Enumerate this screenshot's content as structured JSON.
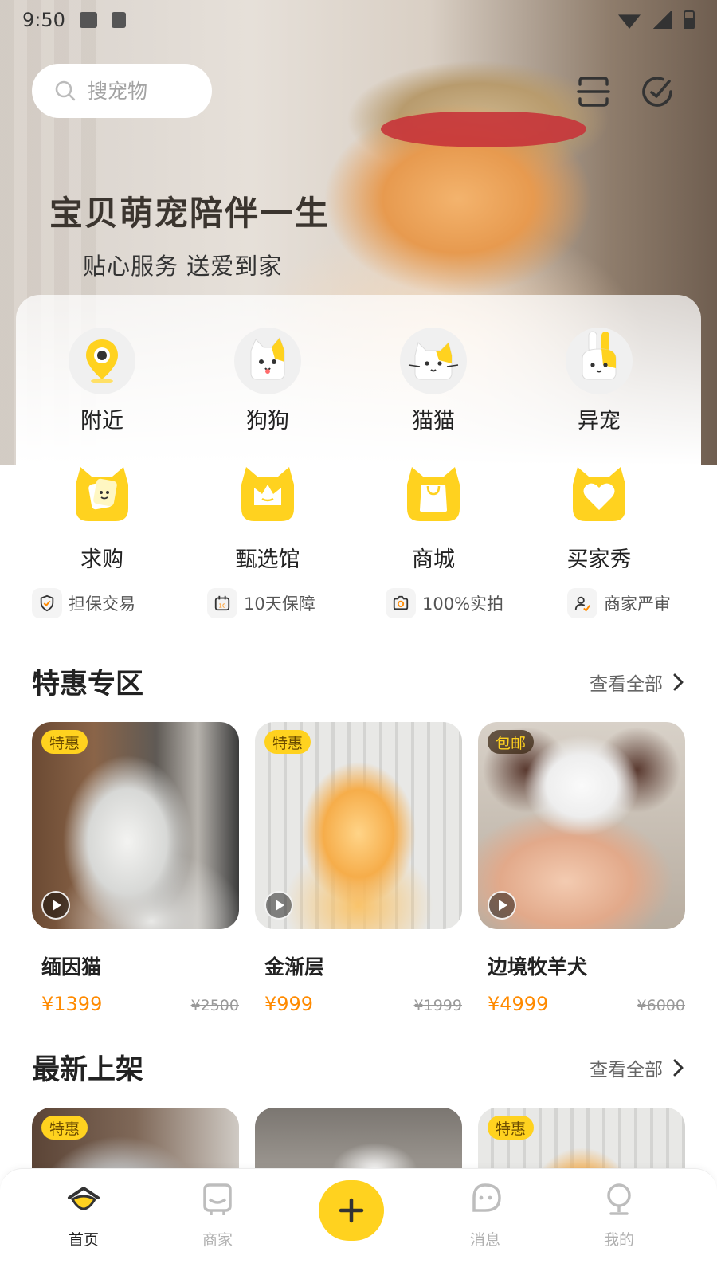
{
  "status_bar": {
    "time": "9:50"
  },
  "search": {
    "placeholder": "搜宠物"
  },
  "hero": {
    "slogan_main": "宝贝萌宠陪伴一生",
    "slogan_sub": "贴心服务 送爱到家"
  },
  "categories_row1": [
    {
      "label": "附近",
      "icon": "location-pin-icon"
    },
    {
      "label": "狗狗",
      "icon": "dog-icon"
    },
    {
      "label": "猫猫",
      "icon": "cat-icon"
    },
    {
      "label": "异宠",
      "icon": "rabbit-icon"
    }
  ],
  "categories_row2": [
    {
      "label": "求购",
      "icon": "wanted-icon"
    },
    {
      "label": "甄选馆",
      "icon": "crown-icon"
    },
    {
      "label": "商城",
      "icon": "shopping-bag-icon"
    },
    {
      "label": "买家秀",
      "icon": "heart-icon"
    }
  ],
  "guarantees": [
    {
      "label": "担保交易",
      "icon": "shield-check-icon"
    },
    {
      "label": "10天保障",
      "icon": "calendar-icon"
    },
    {
      "label": "100%实拍",
      "icon": "camera-icon"
    },
    {
      "label": "商家严审",
      "icon": "user-check-icon"
    }
  ],
  "section_deals": {
    "title": "特惠专区",
    "more": "查看全部",
    "items": [
      {
        "tag": "特惠",
        "name": "缅因猫",
        "price": "¥1399",
        "old_price": "¥2500"
      },
      {
        "tag": "特惠",
        "name": "金渐层",
        "price": "¥999",
        "old_price": "¥1999"
      },
      {
        "tag": "包邮",
        "name": "边境牧羊犬",
        "price": "¥4999",
        "old_price": "¥6000"
      }
    ]
  },
  "section_new": {
    "title": "最新上架",
    "more": "查看全部",
    "items": [
      {
        "tag": "特惠"
      },
      {
        "tag": ""
      },
      {
        "tag": "特惠"
      }
    ]
  },
  "tabbar": {
    "items": [
      {
        "label": "首页",
        "active": true,
        "icon": "home-icon"
      },
      {
        "label": "商家",
        "active": false,
        "icon": "store-icon"
      },
      {
        "label": "",
        "active": false,
        "icon": "plus-icon"
      },
      {
        "label": "消息",
        "active": false,
        "icon": "message-icon"
      },
      {
        "label": "我的",
        "active": false,
        "icon": "profile-icon"
      }
    ]
  },
  "colors": {
    "accent": "#ffd21f",
    "price": "#ff8a00"
  }
}
